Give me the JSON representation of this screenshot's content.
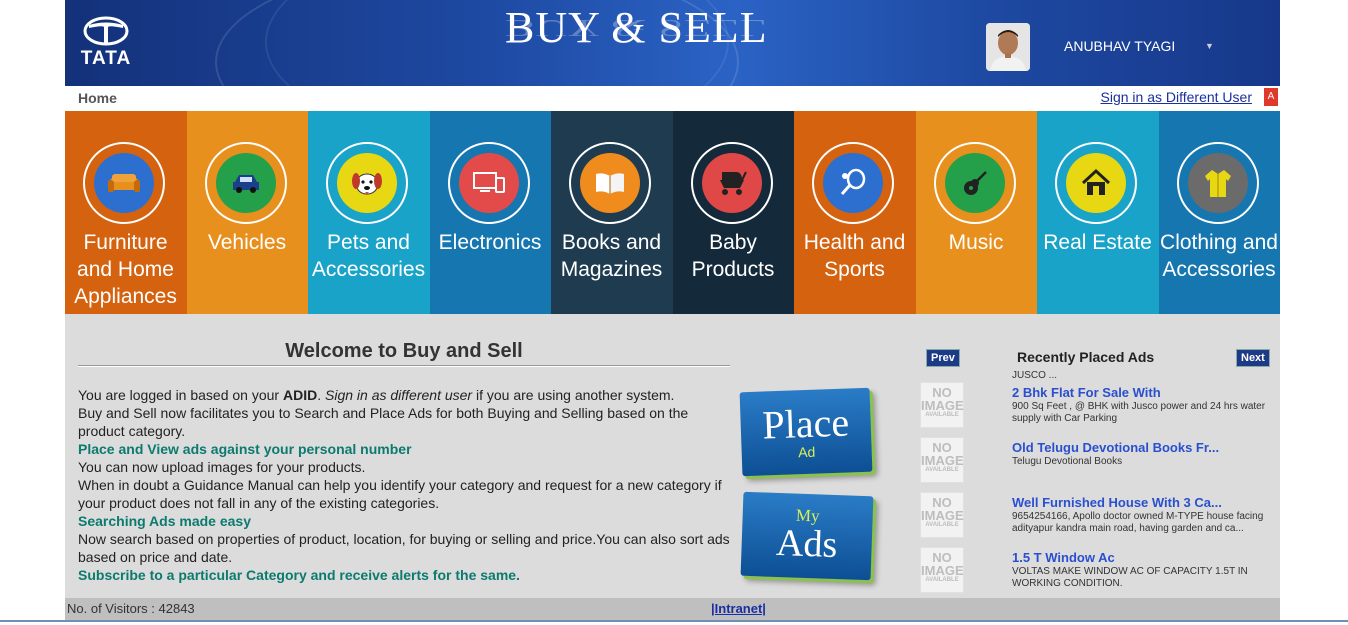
{
  "header": {
    "logo_text": "TATA",
    "app_title": "BUY & SELL",
    "username": "ANUBHAV TYAGI"
  },
  "nav": {
    "home": "Home",
    "signin_different": "Sign in as Different User"
  },
  "categories": [
    {
      "label": "Furniture and Home Appliances",
      "icon": "sofa-icon",
      "bg": "#d4620f",
      "disc": "#2d6fcf"
    },
    {
      "label": "Vehicles",
      "icon": "car-icon",
      "bg": "#e8901d",
      "disc": "#24a04a"
    },
    {
      "label": "Pets and Accessories",
      "icon": "dog-icon",
      "bg": "#1aa3c8",
      "disc": "#e7d813"
    },
    {
      "label": "Electronics",
      "icon": "devices-icon",
      "bg": "#1676b0",
      "disc": "#e34b4b"
    },
    {
      "label": "Books and Magazines",
      "icon": "book-icon",
      "bg": "#1e3b4f",
      "disc": "#f08b1d"
    },
    {
      "label": "Baby Products",
      "icon": "stroller-icon",
      "bg": "#14293a",
      "disc": "#e04848"
    },
    {
      "label": "Health and Sports",
      "icon": "racket-icon",
      "bg": "#d4620f",
      "disc": "#2d6fcf"
    },
    {
      "label": "Music",
      "icon": "guitar-icon",
      "bg": "#e8901d",
      "disc": "#24a04a"
    },
    {
      "label": "Real Estate",
      "icon": "house-icon",
      "bg": "#1aa3c8",
      "disc": "#e7d813"
    },
    {
      "label": "Clothing and Accessories",
      "icon": "jacket-icon",
      "bg": "#1676b0",
      "disc": "#6b6b6b"
    }
  ],
  "welcome": {
    "title": "Welcome to Buy and Sell",
    "p1_pre": "You are logged in based on your ",
    "p1_bold": "ADID",
    "p1_mid": ". ",
    "p1_italic": "Sign in as different user",
    "p1_post": "  if you are using another system.",
    "p2": "Buy and Sell now facilitates you to Search and Place Ads for both Buying and Selling based on the product category.",
    "h1": "Place and View ads against your personal number",
    "p3": "You can now upload images for your products.",
    "p4": "When in doubt a Guidance Manual can help you identify your category and request for a new category if your product does not fall in any of the existing categories.",
    "h2": "Searching Ads made easy",
    "p5": "Now search based on properties of product, location, for buying or selling and price.You can also sort ads based on price and date.",
    "h3": "Subscribe to a particular Category and receive alerts for the same."
  },
  "buttons": {
    "place_big": "Place",
    "place_small": "Ad",
    "myads_small": "My",
    "myads_big": "Ads"
  },
  "recent": {
    "title": "Recently Placed Ads",
    "prev": "Prev",
    "next": "Next",
    "prefix": "JUSCO ...",
    "no_image_text": "NO IMAGE",
    "no_image_sub": "AVAILABLE",
    "ads": [
      {
        "title": "2 Bhk Flat For Sale With",
        "desc": "900 Sq Feet , @ BHK with Jusco power and 24 hrs water supply with Car Parking"
      },
      {
        "title": "Old Telugu Devotional Books Fr...",
        "desc": "Telugu Devotional Books"
      },
      {
        "title": "Well Furnished House With 3 Ca...",
        "desc": "9654254166, Apollo doctor owned M-TYPE house facing adityapur kandra main road, having garden and ca..."
      },
      {
        "title": "1.5 T Window Ac",
        "desc": "VOLTAS MAKE WINDOW AC OF CAPACITY 1.5T IN WORKING CONDITION."
      }
    ]
  },
  "footer": {
    "visitors": "No. of Visitors : 42843",
    "intranet": "|Intranet|"
  }
}
